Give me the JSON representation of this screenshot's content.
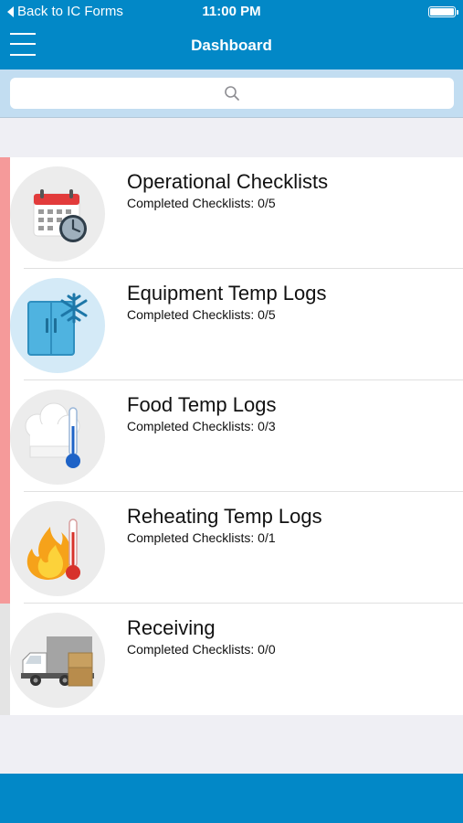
{
  "status_bar": {
    "back_label": "Back to IC Forms",
    "time": "11:00 PM"
  },
  "nav": {
    "title": "Dashboard"
  },
  "search": {
    "placeholder": ""
  },
  "colors": {
    "brand": "#0288c7",
    "pending_stripe": "#f59a9a",
    "empty_stripe": "#e4e4e4"
  },
  "categories": [
    {
      "name": "Operational Checklists",
      "completed_label": "Completed Checklists: 0/5",
      "icon": "calendar-clock-icon",
      "completed": 0,
      "total": 5
    },
    {
      "name": "Equipment Temp Logs",
      "completed_label": "Completed Checklists: 0/5",
      "icon": "freezer-icon",
      "completed": 0,
      "total": 5
    },
    {
      "name": "Food Temp Logs",
      "completed_label": "Completed Checklists: 0/3",
      "icon": "chef-hat-thermometer-icon",
      "completed": 0,
      "total": 3
    },
    {
      "name": "Reheating Temp Logs",
      "completed_label": "Completed Checklists: 0/1",
      "icon": "flame-thermometer-icon",
      "completed": 0,
      "total": 1
    },
    {
      "name": "Receiving",
      "completed_label": "Completed Checklists: 0/0",
      "icon": "delivery-truck-icon",
      "completed": 0,
      "total": 0
    }
  ]
}
